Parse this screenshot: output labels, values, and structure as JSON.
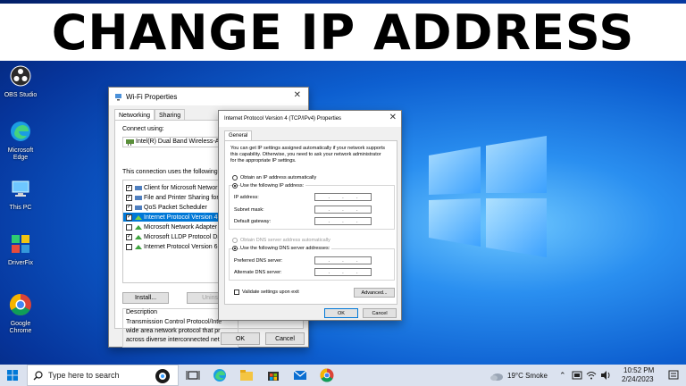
{
  "banner": {
    "text": "CHANGE IP ADDRESS"
  },
  "desktop_icons": [
    {
      "label": "OBS Studio",
      "icon": "obs-icon"
    },
    {
      "label": "Microsoft Edge",
      "icon": "edge-icon"
    },
    {
      "label": "This PC",
      "icon": "computer-icon"
    },
    {
      "label": "DriverFix",
      "icon": "driverfix-icon"
    },
    {
      "label": "Google Chrome",
      "icon": "chrome-icon"
    }
  ],
  "wifi_dialog": {
    "title": "Wi-Fi Properties",
    "tabs": [
      "Networking",
      "Sharing"
    ],
    "connect_using_label": "Connect using:",
    "adapter": "Intel(R) Dual Band Wireless-AC",
    "items_label": "This connection uses the following ite",
    "items": [
      {
        "label": "Client for Microsoft Networks",
        "checked": true
      },
      {
        "label": "File and Printer Sharing for M",
        "checked": true
      },
      {
        "label": "QoS Packet Scheduler",
        "checked": true
      },
      {
        "label": "Internet Protocol Version 4 (",
        "checked": true,
        "selected": true
      },
      {
        "label": "Microsoft Network Adapter M",
        "checked": false
      },
      {
        "label": "Microsoft LLDP Protocol Dri",
        "checked": true
      },
      {
        "label": "Internet Protocol Version 6 (",
        "checked": false
      }
    ],
    "install_label": "Install...",
    "uninstall_label": "Uninsta",
    "description_label": "Description",
    "description_lines": [
      "Transmission Control Protocol/Inte",
      "wide area network protocol that pr",
      "across diverse interconnected net"
    ],
    "ok_label": "OK",
    "cancel_label": "Cancel"
  },
  "ipv4_dialog": {
    "title": "Internet Protocol Version 4 (TCP/IPv4) Properties",
    "tab": "General",
    "intro_lines": [
      "You can get IP settings assigned automatically if your network supports",
      "this capability. Otherwise, you need to ask your network administrator",
      "for the appropriate IP settings."
    ],
    "obtain_ip_auto": "Obtain an IP address automatically",
    "use_following_ip": "Use the following IP address:",
    "ip_address_label": "IP address:",
    "subnet_mask_label": "Subnet mask:",
    "default_gateway_label": "Default gateway:",
    "obtain_dns_auto": "Obtain DNS server address automatically",
    "use_following_dns": "Use the following DNS server addresses:",
    "preferred_dns_label": "Preferred DNS server:",
    "alternate_dns_label": "Alternate DNS server:",
    "validate_label": "Validate settings upon exit",
    "advanced_label": "Advanced...",
    "ok_label": "OK",
    "cancel_label": "Cancel"
  },
  "taskbar": {
    "search_placeholder": "Type here to search",
    "weather": "19°C  Smoke",
    "time": "10:52 PM",
    "date": "2/24/2023"
  },
  "colors": {
    "accent": "#0078d7",
    "taskbar": "#dbe2ef"
  }
}
